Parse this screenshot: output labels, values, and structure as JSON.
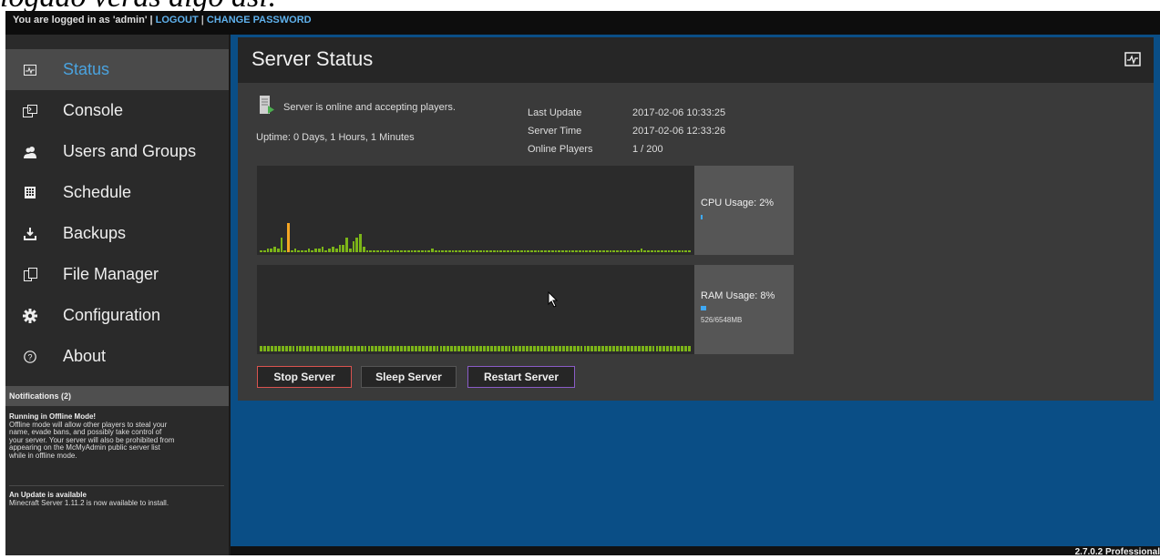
{
  "caption": "logado veras algo asi:",
  "topbar": {
    "login_text": "You are logged in as 'admin' |",
    "logout": "LOGOUT",
    "separator": "|",
    "change_password": "CHANGE PASSWORD"
  },
  "sidebar": {
    "items": [
      {
        "label": "Status",
        "icon": "status-monitor-icon",
        "active": true
      },
      {
        "label": "Console",
        "icon": "console-icon"
      },
      {
        "label": "Users and Groups",
        "icon": "users-icon"
      },
      {
        "label": "Schedule",
        "icon": "schedule-icon"
      },
      {
        "label": "Backups",
        "icon": "backup-icon"
      },
      {
        "label": "File Manager",
        "icon": "file-manager-icon"
      },
      {
        "label": "Configuration",
        "icon": "gear-icon"
      },
      {
        "label": "About",
        "icon": "help-icon"
      }
    ],
    "notifications_header": "Notifications (2)",
    "notifications": [
      {
        "title": "Running in Offline Mode!",
        "lines": [
          "Offline mode will allow other players to steal your",
          "name, evade bans, and possibly take control of",
          "your server. Your server will also be prohibited from",
          "appearing on the McMyAdmin public server list",
          "while in offline mode."
        ]
      },
      {
        "title": "An Update is available",
        "lines": [
          "Minecraft Server 1.11.2 is now available to install."
        ]
      }
    ]
  },
  "main": {
    "title": "Server Status",
    "status_text": "Server is online and accepting players.",
    "uptime": "Uptime: 0 Days, 1 Hours, 1 Minutes",
    "last_update_label": "Last Update",
    "last_update_value": "2017-02-06 10:33:25",
    "server_time_label": "Server Time",
    "server_time_value": "2017-02-06 12:33:26",
    "online_players_label": "Online Players",
    "online_players_value": "1 / 200",
    "cpu_label": "CPU Usage: 2%",
    "cpu_percent": 2,
    "ram_label": "RAM Usage: 8%",
    "ram_percent": 8,
    "ram_detail": "526/6548MB",
    "buttons": {
      "stop": "Stop Server",
      "sleep": "Sleep Server",
      "restart": "Restart Server"
    }
  },
  "colors": {
    "accent": "#4aa3df",
    "content_bg": "#0a4e86",
    "graph_green": "#7cb518",
    "graph_orange": "#f5a623",
    "stop_border": "#d9534f",
    "restart_border": "#8a5cc7"
  },
  "chart_data": [
    {
      "type": "bar",
      "name": "cpu-history",
      "values": [
        1,
        1,
        2,
        2,
        3,
        2,
        8,
        1,
        16,
        1,
        2,
        1,
        1,
        1,
        2,
        1,
        2,
        2,
        3,
        1,
        2,
        3,
        2,
        4,
        4,
        8,
        2,
        6,
        8,
        10,
        3,
        1,
        1,
        1,
        1,
        1,
        1,
        1,
        1,
        1,
        1,
        1,
        1,
        1,
        1,
        1,
        1,
        1,
        1,
        1,
        2,
        1,
        1,
        1,
        1,
        1,
        1,
        1,
        1,
        1,
        1,
        1,
        1,
        1,
        1,
        1,
        1,
        1,
        1,
        1,
        1,
        1,
        1,
        1,
        1,
        1,
        1,
        1,
        1,
        1,
        1,
        1,
        1,
        1,
        1,
        1,
        1,
        1,
        1,
        1,
        1,
        1,
        1,
        1,
        1,
        1,
        1,
        1,
        1,
        1,
        1,
        1,
        1,
        1,
        1,
        1,
        1,
        1,
        1,
        1,
        1,
        2,
        1,
        1,
        1,
        1,
        1,
        1,
        1,
        1,
        1,
        1,
        1,
        1,
        1,
        1
      ],
      "highlight_index": 8
    },
    {
      "type": "bar",
      "name": "ram-history",
      "values": [
        4,
        4,
        4,
        4,
        4,
        4,
        4,
        4,
        4,
        4,
        4,
        4,
        4,
        4,
        4,
        4,
        4,
        4,
        4,
        4,
        4,
        4,
        4,
        4,
        4,
        4,
        4,
        4,
        4,
        4,
        4,
        4,
        4,
        4,
        4,
        4,
        4,
        4,
        4,
        4,
        4,
        4,
        4,
        4,
        4,
        4,
        4,
        4,
        4,
        4,
        4,
        4,
        4,
        4,
        4,
        4,
        4,
        4,
        4,
        4,
        4,
        4,
        4,
        4,
        4,
        4,
        4,
        4,
        4,
        4,
        4,
        4,
        4,
        4,
        4,
        4,
        4,
        4,
        4,
        4,
        4,
        4,
        4,
        4,
        4,
        4,
        4,
        4,
        4,
        4,
        4,
        4,
        4,
        4,
        4,
        4,
        4,
        4,
        4,
        4,
        4,
        4,
        4,
        4,
        4,
        4,
        4,
        4,
        4,
        4,
        4,
        4,
        4,
        4,
        4,
        4,
        4,
        4,
        4,
        4
      ]
    }
  ],
  "footer": {
    "version": "2.7.0.2 Professional"
  }
}
